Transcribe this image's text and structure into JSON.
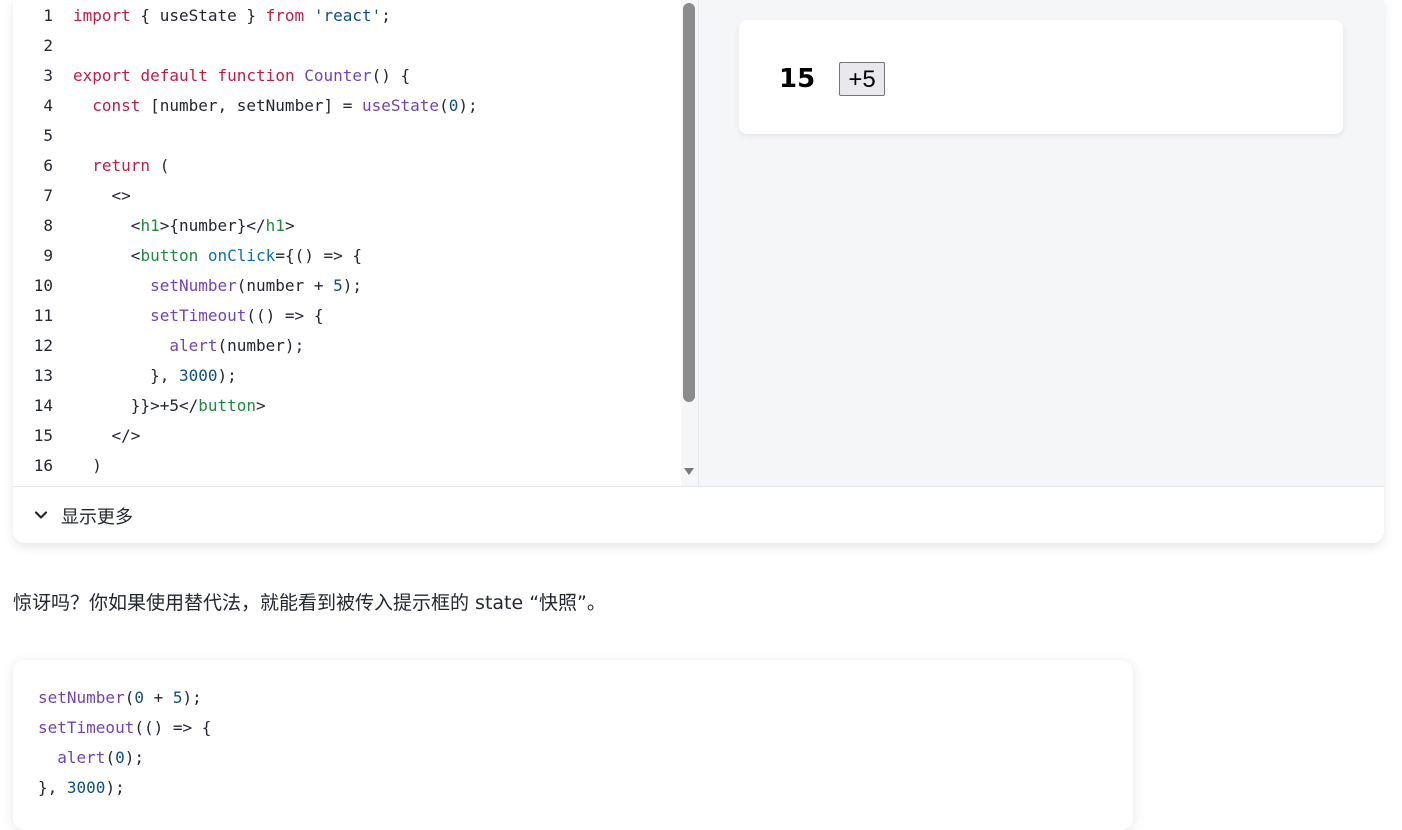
{
  "editor": {
    "line_numbers": [
      "1",
      "2",
      "3",
      "4",
      "5",
      "6",
      "7",
      "8",
      "9",
      "10",
      "11",
      "12",
      "13",
      "14",
      "15",
      "16"
    ],
    "lines": [
      [
        [
          "kw",
          "import"
        ],
        [
          "pl",
          " { useState } "
        ],
        [
          "kw",
          "from"
        ],
        [
          "pl",
          " "
        ],
        [
          "str",
          "'react'"
        ],
        [
          "pl",
          ";"
        ]
      ],
      [],
      [
        [
          "kw",
          "export"
        ],
        [
          "pl",
          " "
        ],
        [
          "kw",
          "default"
        ],
        [
          "pl",
          " "
        ],
        [
          "kw",
          "function"
        ],
        [
          "pl",
          " "
        ],
        [
          "fn",
          "Counter"
        ],
        [
          "pl",
          "() {"
        ]
      ],
      [
        [
          "pl",
          "  "
        ],
        [
          "kw",
          "const"
        ],
        [
          "pl",
          " [number, setNumber] = "
        ],
        [
          "fn",
          "useState"
        ],
        [
          "pl",
          "("
        ],
        [
          "num",
          "0"
        ],
        [
          "pl",
          ");"
        ]
      ],
      [],
      [
        [
          "pl",
          "  "
        ],
        [
          "kw",
          "return"
        ],
        [
          "pl",
          " ("
        ]
      ],
      [
        [
          "pl",
          "    <>"
        ]
      ],
      [
        [
          "pl",
          "      <"
        ],
        [
          "tag",
          "h1"
        ],
        [
          "pl",
          ">{number}</"
        ],
        [
          "tag",
          "h1"
        ],
        [
          "pl",
          ">"
        ]
      ],
      [
        [
          "pl",
          "      <"
        ],
        [
          "tag",
          "button"
        ],
        [
          "pl",
          " "
        ],
        [
          "attr",
          "onClick"
        ],
        [
          "pl",
          "={() => {"
        ]
      ],
      [
        [
          "pl",
          "        "
        ],
        [
          "fn",
          "setNumber"
        ],
        [
          "pl",
          "(number + "
        ],
        [
          "num",
          "5"
        ],
        [
          "pl",
          ");"
        ]
      ],
      [
        [
          "pl",
          "        "
        ],
        [
          "fn",
          "setTimeout"
        ],
        [
          "pl",
          "(() => {"
        ]
      ],
      [
        [
          "pl",
          "          "
        ],
        [
          "fn",
          "alert"
        ],
        [
          "pl",
          "(number);"
        ]
      ],
      [
        [
          "pl",
          "        }, "
        ],
        [
          "num",
          "3000"
        ],
        [
          "pl",
          ");"
        ]
      ],
      [
        [
          "pl",
          "      }}>+5</"
        ],
        [
          "tag",
          "button"
        ],
        [
          "pl",
          ">"
        ]
      ],
      [
        [
          "pl",
          "    </>"
        ]
      ],
      [
        [
          "pl",
          "  )"
        ]
      ]
    ]
  },
  "preview": {
    "counter_value": "15",
    "button_label": "+5"
  },
  "footer": {
    "show_more_label": "显示更多",
    "chevron_icon": "chevron-down-icon"
  },
  "paragraph": "惊讶吗？你如果使用替代法，就能看到被传入提示框的 state “快照”。",
  "snippet": {
    "lines": [
      [
        [
          "fn",
          "setNumber"
        ],
        [
          "pl",
          "("
        ],
        [
          "num",
          "0"
        ],
        [
          "pl",
          " + "
        ],
        [
          "num",
          "5"
        ],
        [
          "pl",
          ");"
        ]
      ],
      [
        [
          "fn",
          "setTimeout"
        ],
        [
          "pl",
          "(() => {"
        ]
      ],
      [
        [
          "pl",
          "  "
        ],
        [
          "fn",
          "alert"
        ],
        [
          "pl",
          "("
        ],
        [
          "num",
          "0"
        ],
        [
          "pl",
          ");"
        ]
      ],
      [
        [
          "pl",
          "}, "
        ],
        [
          "num",
          "3000"
        ],
        [
          "pl",
          ");"
        ]
      ]
    ]
  },
  "colors": {
    "keyword": "#c71942",
    "function": "#6f42c1",
    "string": "#0c4e8b",
    "tag": "#1a8c3a",
    "attribute": "#0a6fc2"
  }
}
